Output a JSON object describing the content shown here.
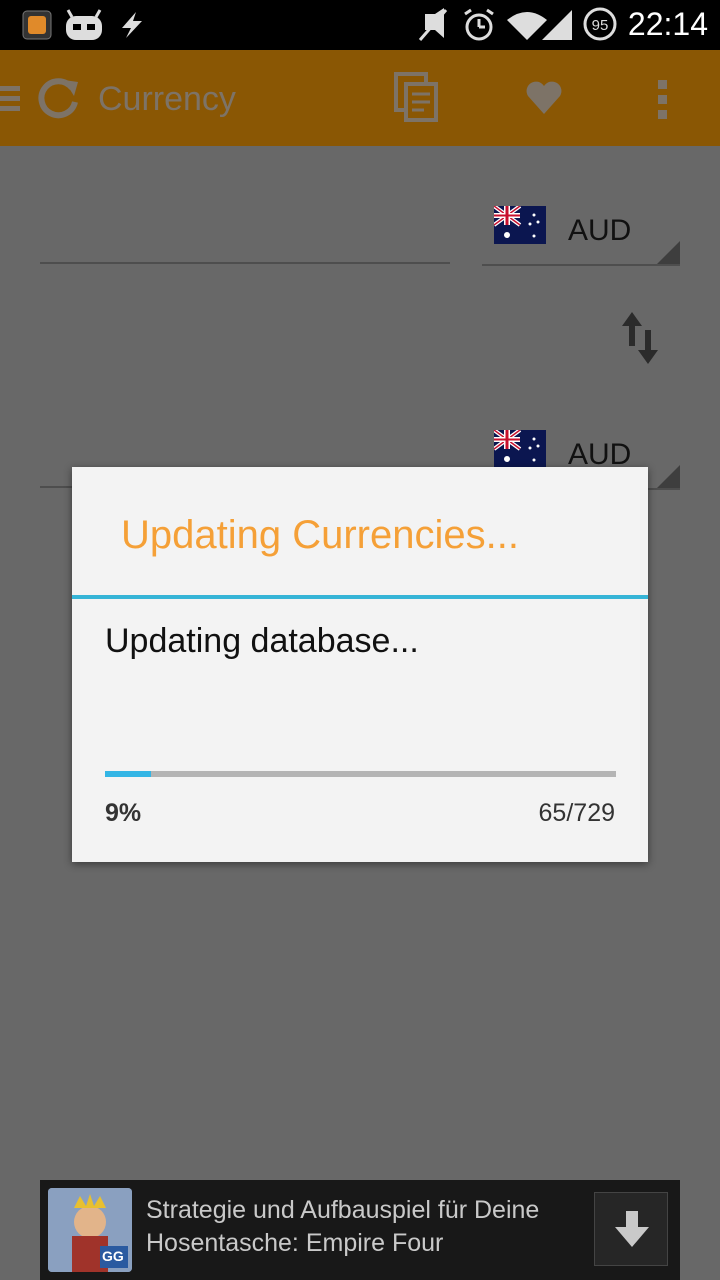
{
  "status_bar": {
    "time": "22:14",
    "battery": "95",
    "icons": [
      "app-notification-icon",
      "android-robot-icon",
      "usb-debug-icon",
      "mute-icon",
      "alarm-icon",
      "wifi-icon",
      "signal-icon",
      "battery-icon"
    ]
  },
  "action_bar": {
    "title": "Currency",
    "icons": [
      "menu-icon",
      "refresh-icon",
      "copy-icon",
      "favorite-icon",
      "overflow-menu-icon"
    ]
  },
  "converter": {
    "from": {
      "amount": "",
      "currency": "AUD"
    },
    "to": {
      "amount": "",
      "currency": "AUD"
    }
  },
  "dialog": {
    "title": "Updating Currencies...",
    "message": "Updating database...",
    "progress_fraction": 0.09,
    "percent_label": "9%",
    "count_label": "65/729"
  },
  "ad": {
    "text": "Strategie und Aufbauspiel für Deine Hosentasche: Empire Four",
    "thumbnail_label": "GG"
  },
  "colors": {
    "dialog_title": "#f5a037",
    "accent_blue": "#33b5e5",
    "action_bar": "#8a5704"
  }
}
